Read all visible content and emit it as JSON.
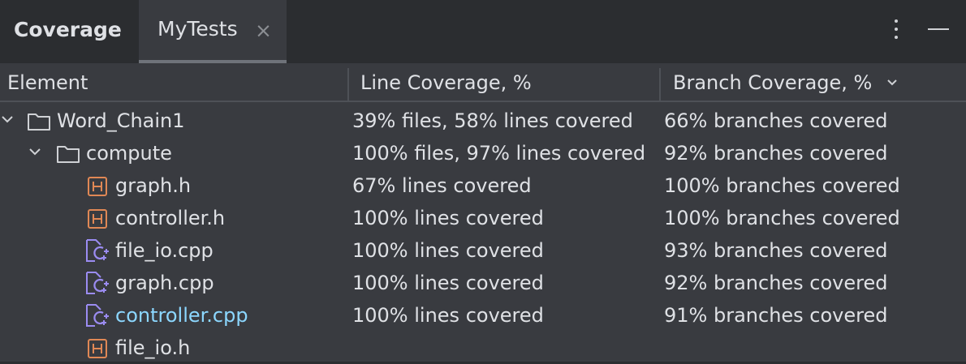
{
  "tabs": {
    "title": "Coverage",
    "active_label": "MyTests",
    "close_glyph": "×"
  },
  "columns": [
    "Element",
    "Line Coverage, %",
    "Branch Coverage, %"
  ],
  "rows": [
    {
      "name": "Word_Chain1",
      "icon": "folder-icon",
      "expander": "chevron-down-icon",
      "line": "39% files, 58% lines covered",
      "branch": "66% branches covered"
    },
    {
      "name": "compute",
      "icon": "folder-icon",
      "expander": "chevron-down-icon",
      "line": "100% files, 97% lines covered",
      "branch": "92% branches covered"
    },
    {
      "name": "graph.h",
      "icon": "header-file-icon",
      "line": "67% lines covered",
      "branch": "100% branches covered"
    },
    {
      "name": "controller.h",
      "icon": "header-file-icon",
      "line": "100% lines covered",
      "branch": "100% branches covered"
    },
    {
      "name": "file_io.cpp",
      "icon": "cpp-file-icon",
      "line": "100% lines covered",
      "branch": "93% branches covered"
    },
    {
      "name": "graph.cpp",
      "icon": "cpp-file-icon",
      "line": "100% lines covered",
      "branch": "92% branches covered"
    },
    {
      "name": "controller.cpp",
      "icon": "cpp-file-icon",
      "line": "100% lines covered",
      "branch": "91% branches covered"
    },
    {
      "name": "file_io.h",
      "icon": "header-file-icon",
      "line": "",
      "branch": ""
    }
  ],
  "colors": {
    "background": "#2b2d30",
    "panel": "#393b40",
    "text": "#dfe1e5",
    "header_icon": "#e08855",
    "cpp_icon": "#9b8cf2",
    "link_text": "#8cd7ff"
  }
}
